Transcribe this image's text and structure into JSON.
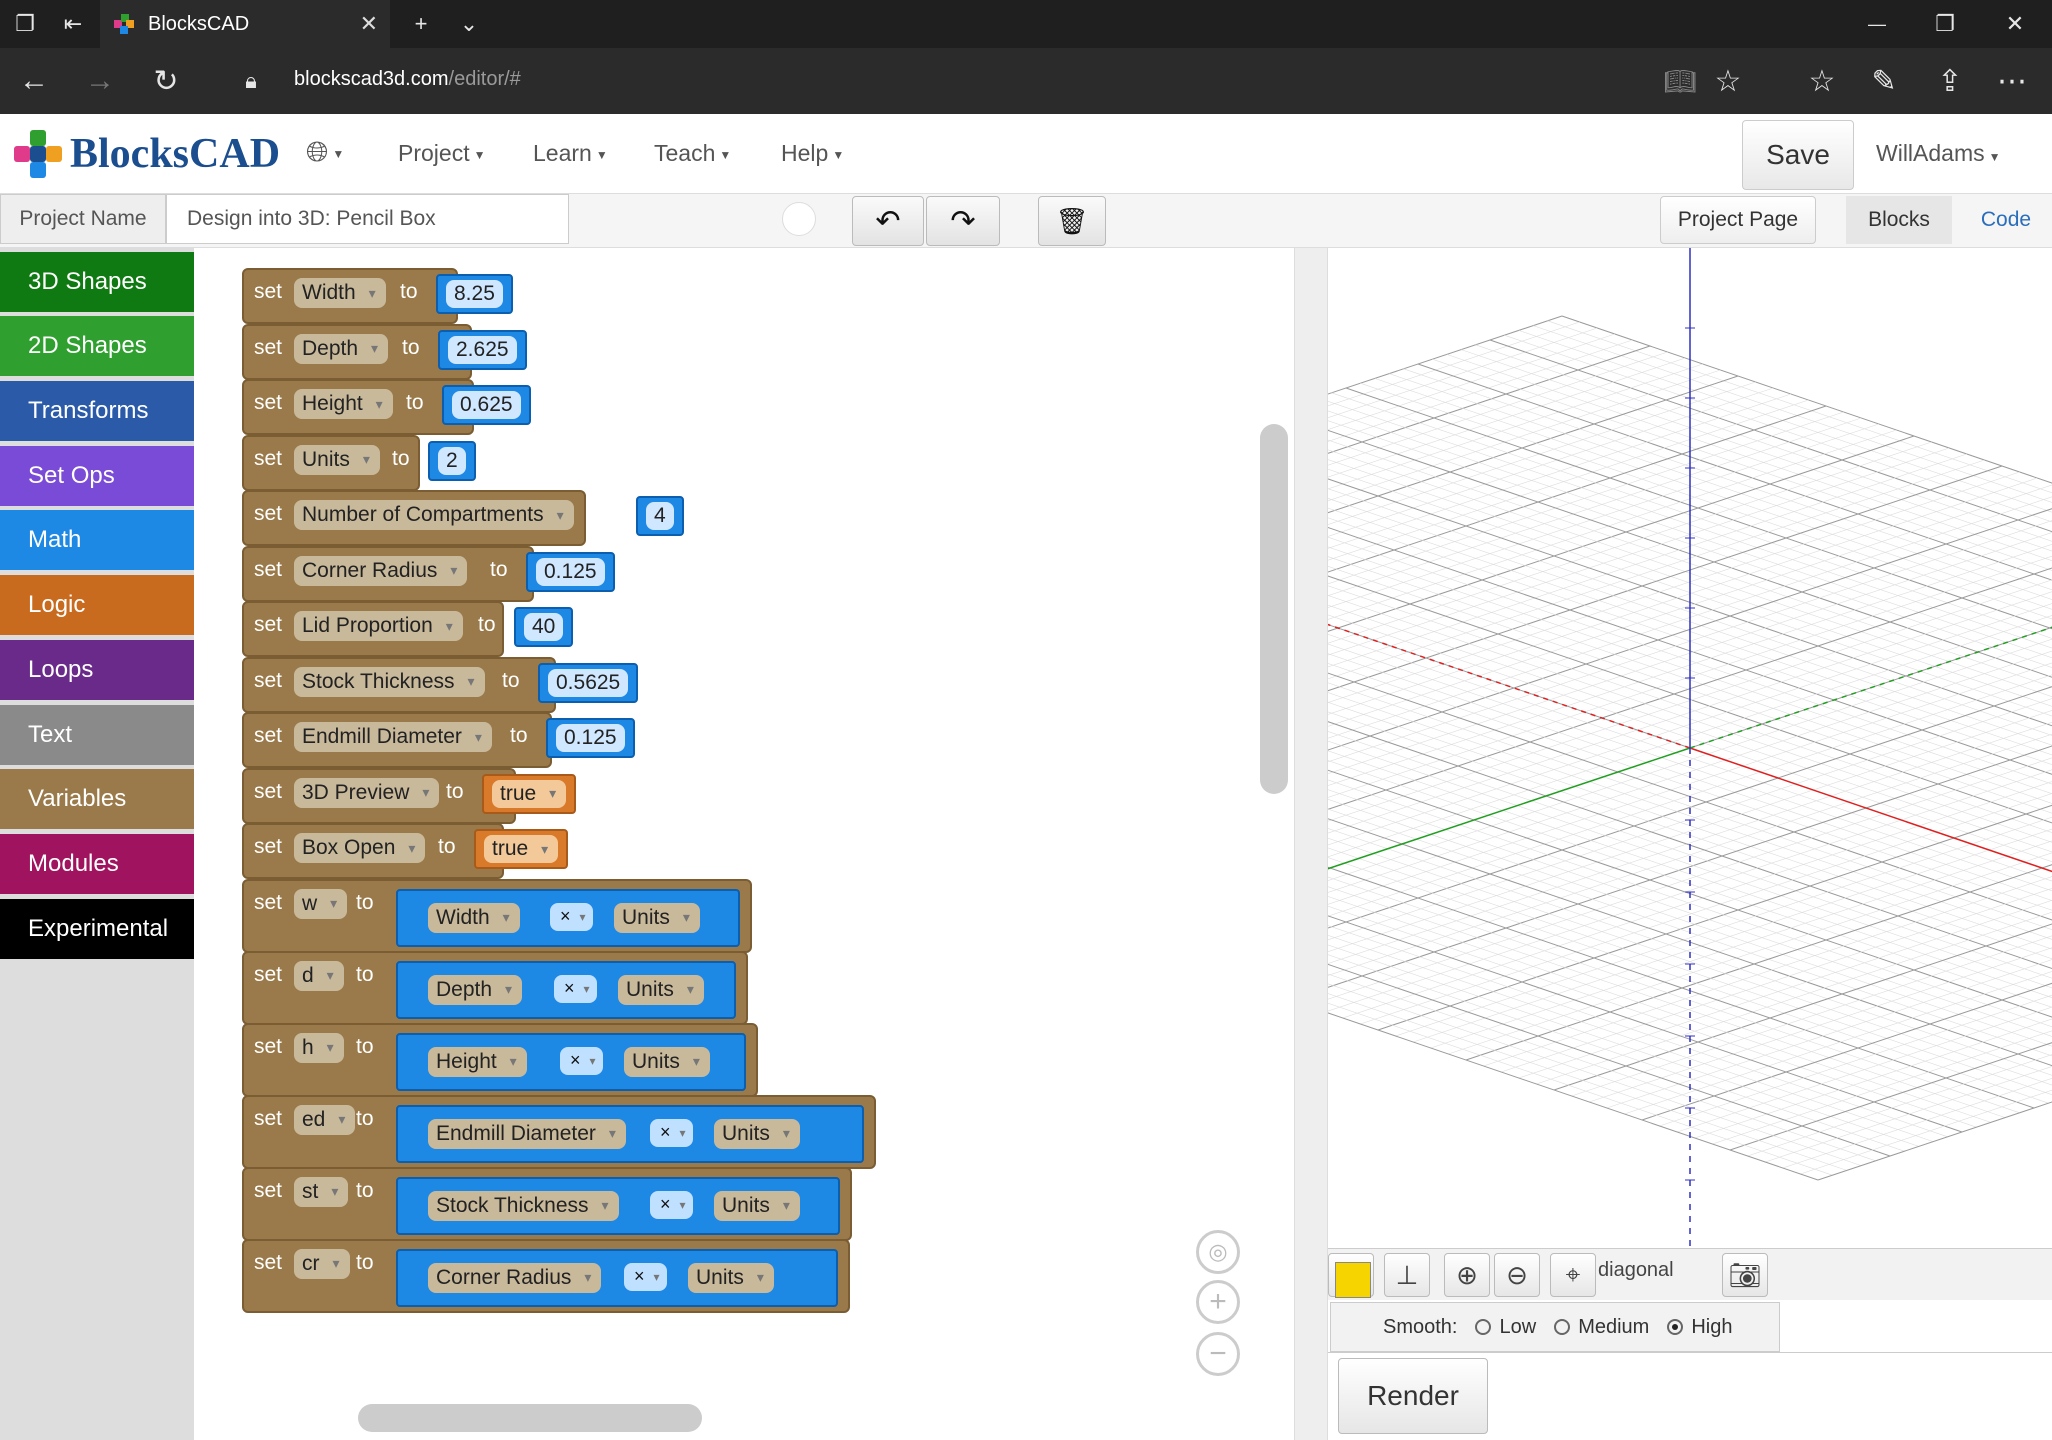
{
  "browser": {
    "tab_title": "BlocksCAD",
    "url_host": "blockscad3d.com",
    "url_path": "/editor/#"
  },
  "app": {
    "logo_text": "BlocksCAD",
    "menu": [
      "Project",
      "Learn",
      "Teach",
      "Help"
    ],
    "save_label": "Save",
    "user": "WillAdams"
  },
  "toolbar": {
    "project_name_label": "Project Name",
    "project_name_value": "Design into 3D: Pencil Box",
    "project_page_label": "Project Page",
    "tab_blocks": "Blocks",
    "tab_code": "Code"
  },
  "categories": [
    {
      "label": "3D Shapes",
      "color": "#0f7a12"
    },
    {
      "label": "2D Shapes",
      "color": "#2fa02f"
    },
    {
      "label": "Transforms",
      "color": "#2a5aa8"
    },
    {
      "label": "Set Ops",
      "color": "#7a4bd6"
    },
    {
      "label": "Math",
      "color": "#1e88e5"
    },
    {
      "label": "Logic",
      "color": "#c96b1f"
    },
    {
      "label": "Loops",
      "color": "#6a2a8a"
    },
    {
      "label": "Text",
      "color": "#8a8a8a"
    },
    {
      "label": "Variables",
      "color": "#9a7a4a"
    },
    {
      "label": "Modules",
      "color": "#a0135e"
    },
    {
      "label": "Experimental",
      "color": "#000000"
    }
  ],
  "blocks": {
    "kw_set": "set",
    "kw_to": "to",
    "simple": [
      {
        "var": "Width",
        "value": "8.25",
        "kind": "num"
      },
      {
        "var": "Depth",
        "value": "2.625",
        "kind": "num"
      },
      {
        "var": "Height",
        "value": "0.625",
        "kind": "num"
      },
      {
        "var": "Units",
        "value": "2",
        "kind": "num"
      },
      {
        "var": "Number of Compartments",
        "value": "4",
        "kind": "num"
      },
      {
        "var": "Corner Radius",
        "value": "0.125",
        "kind": "num"
      },
      {
        "var": "Lid Proportion",
        "value": "40",
        "kind": "num"
      },
      {
        "var": "Stock Thickness",
        "value": "0.5625",
        "kind": "num"
      },
      {
        "var": "Endmill Diameter",
        "value": "0.125",
        "kind": "num"
      },
      {
        "var": "3D Preview",
        "value": "true",
        "kind": "bool"
      },
      {
        "var": "Box Open",
        "value": "true",
        "kind": "bool"
      }
    ],
    "multiply": [
      {
        "var": "w",
        "left": "Width",
        "op": "×",
        "right": "Units"
      },
      {
        "var": "d",
        "left": "Depth",
        "op": "×",
        "right": "Units"
      },
      {
        "var": "h",
        "left": "Height",
        "op": "×",
        "right": "Units"
      },
      {
        "var": "ed",
        "left": "Endmill Diameter",
        "op": "×",
        "right": "Units"
      },
      {
        "var": "st",
        "left": "Stock Thickness",
        "op": "×",
        "right": "Units"
      },
      {
        "var": "cr",
        "left": "Corner Radius",
        "op": "×",
        "right": "Units"
      }
    ]
  },
  "viewer": {
    "color": "#f5d400",
    "view_mode": "diagonal",
    "smooth_label": "Smooth:",
    "smooth_options": [
      "Low",
      "Medium",
      "High"
    ],
    "smooth_selected": "High",
    "render_label": "Render"
  }
}
